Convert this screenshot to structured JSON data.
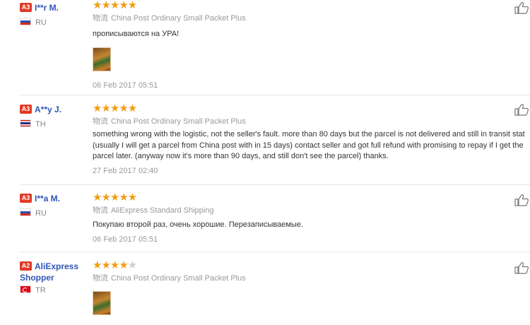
{
  "reviews": [
    {
      "level": "A3",
      "name": "I**r M.",
      "country": "RU",
      "stars": "★★★★★",
      "stars_off": "",
      "shipping_cn": "物流",
      "shipping": "China Post Ordinary Small Packet Plus",
      "text": "прописываются на УРА!",
      "has_photo": true,
      "date": "06 Feb 2017 05:51"
    },
    {
      "level": "A3",
      "name": "A**y J.",
      "country": "TH",
      "stars": "★★★★★",
      "stars_off": "",
      "shipping_cn": "物流",
      "shipping": "China Post Ordinary Small Packet Plus",
      "text_lines": [
        "something wrong with the logistic, not the seller's fault. more than 80 days but the parcel is not delivered and still in transit stat",
        "(usually I will get a parcel from China post with in 15 days) contact seller and got full refund with promising to repay if I get the",
        "parcel later. (anyway now it's more than 90 days, and still don't see the parcel) thanks."
      ],
      "date": "27 Feb 2017 02:40"
    },
    {
      "level": "A3",
      "name": "I**a M.",
      "country": "RU",
      "stars": "★★★★★",
      "stars_off": "",
      "shipping_cn": "物流",
      "shipping": "AliExpress Standard Shipping",
      "text": "Покупаю второй раз, очень хорошие. Перезаписываемые.",
      "date": "06 Feb 2017 05:51"
    },
    {
      "level": "A2",
      "name_line1": "AliExpress",
      "name_line2": "Shopper",
      "country": "TR",
      "stars": "★★★★",
      "stars_off": "★",
      "shipping_cn": "物流",
      "shipping": "China Post Ordinary Small Packet Plus",
      "has_photo": true
    }
  ],
  "icons": {
    "like": "thumbs-up-icon"
  },
  "colors": {
    "star": "#f29d14",
    "level_badge": "#e03a26",
    "username": "#2f54b8"
  }
}
